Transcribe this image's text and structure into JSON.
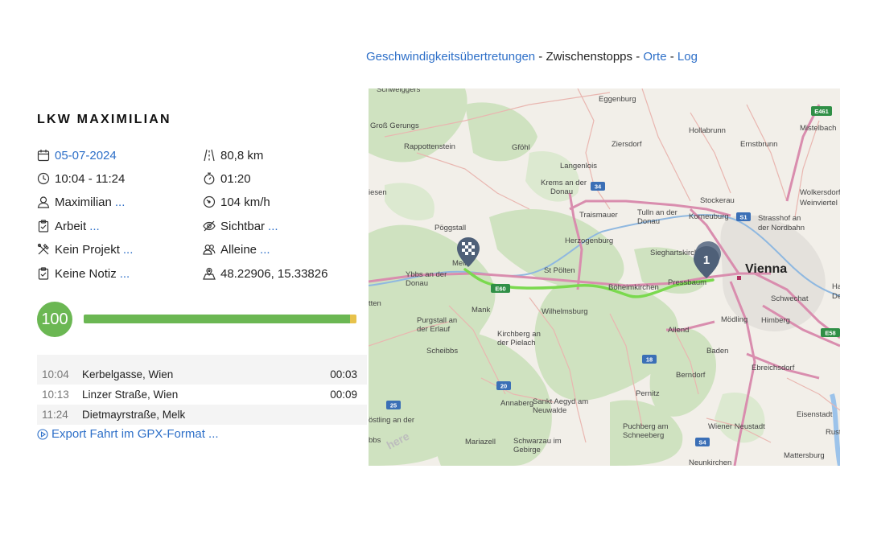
{
  "tabs": [
    {
      "label": "Geschwindigkeitsübertretungen",
      "link": true
    },
    {
      "label": "Zwischenstopps",
      "link": false
    },
    {
      "label": "Orte",
      "link": true
    },
    {
      "label": "Log",
      "link": true
    }
  ],
  "tab_separator": "-",
  "trip": {
    "title": "LKW MAXIMILIAN",
    "date": "05-07-2024",
    "time_range": "10:04 - 11:24",
    "driver": "Maximilian",
    "category": "Arbeit",
    "project": "Kein Projekt",
    "note": "Keine Notiz",
    "distance": "80,8 km",
    "duration": "01:20",
    "max_speed": "104 km/h",
    "visibility": "Sichtbar",
    "passengers": "Alleine",
    "coordinates": "48.22906, 15.33826",
    "more": "..."
  },
  "score": {
    "value": "100",
    "fraction_green": 0.975,
    "fraction_yellow": 0.025,
    "green_color": "#6bb753",
    "yellow_color": "#e7c24b"
  },
  "stops": [
    {
      "time": "10:04",
      "place": "Kerbelgasse, Wien",
      "duration": "00:03"
    },
    {
      "time": "10:13",
      "place": "Linzer Straße, Wien",
      "duration": "00:09"
    },
    {
      "time": "11:24",
      "place": "Dietmayrstraße, Melk",
      "duration": ""
    }
  ],
  "export_label": "Export Fahrt im GPX-Format ...",
  "map": {
    "labels": [
      "Schweiggers",
      "Eggenburg",
      "Groß Gerungs",
      "Hollabrunn",
      "Mistelbach",
      "Rappottenstein",
      "Gföhl",
      "Ziersdorf",
      "Ernstbrunn",
      "Langenlois",
      "Krems an der",
      "Donau",
      "Stockerau",
      "Wolkersdorf im",
      "Weinviertel",
      "iesen",
      "Traismauer",
      "Tulln an der",
      "Donau",
      "Korneuburg",
      "Strasshof an",
      "der Nordbahn",
      "Pöggstall",
      "Herzogenburg",
      "Sieghartskirchen",
      "Ybbs an der",
      "Donau",
      "St Pölten",
      "Böheimkirchen",
      "Pressbaum",
      "Ha",
      "De",
      "Schwechat",
      "tten",
      "Mank",
      "Wilhelmsburg",
      "Purgstall an",
      "der Erlauf",
      "Kirchberg an",
      "der Pielach",
      "Allend",
      "Mödling",
      "Himberg",
      "Scheibbs",
      "Baden",
      "Ebreichsdorf",
      "Berndorf",
      "Pernitz",
      "Annaberg",
      "Sankt Aegyd am",
      "Neuwalde",
      "Eisenstadt",
      "östling an der",
      "bbs",
      "Puchberg am",
      "Schneeberg",
      "Wiener Neustadt",
      "Rust",
      "Mariazell",
      "Schwarzau im",
      "Gebirge",
      "Mattersburg",
      "Neunkirchen",
      "Melk"
    ],
    "city_label": "Vienna",
    "road_shields": [
      "E461",
      "34",
      "S1",
      "E60",
      "E58",
      "18",
      "20",
      "25",
      "S4"
    ],
    "pin_number": "1",
    "logo_text": "here",
    "route_color": "#7ad94e"
  }
}
